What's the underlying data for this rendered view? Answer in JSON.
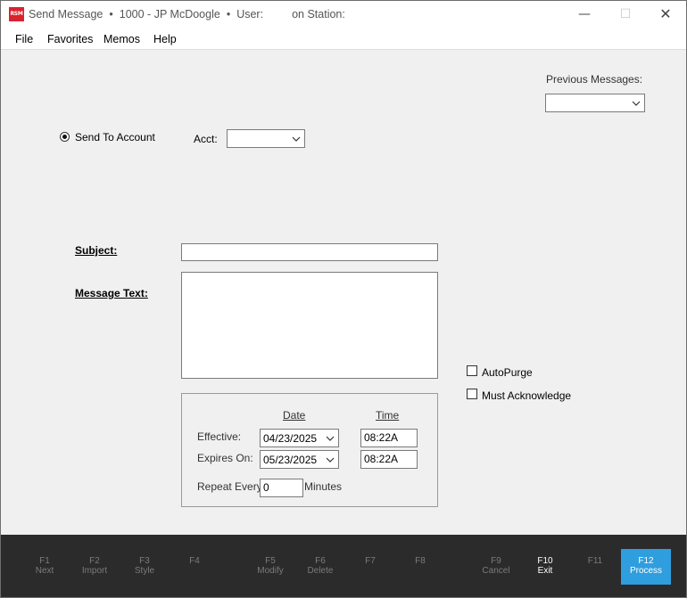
{
  "window": {
    "title": "Send Message",
    "account_info": "1000 - JP McDoogle",
    "user_label": "User:",
    "station_label": "on Station:",
    "logo_text": "RSM"
  },
  "menu": [
    "File",
    "Favorites",
    "Memos",
    "Help"
  ],
  "previous_messages": {
    "label": "Previous Messages:",
    "value": ""
  },
  "send_to_account": {
    "label": "Send To Account",
    "selected": true
  },
  "acct": {
    "label": "Acct:",
    "value": ""
  },
  "subject": {
    "label": "Subject:",
    "value": ""
  },
  "message_text": {
    "label": "Message Text:",
    "value": ""
  },
  "autopurge": {
    "label": "AutoPurge",
    "checked": false
  },
  "must_acknowledge": {
    "label": "Must Acknowledge",
    "checked": false
  },
  "schedule": {
    "date_header": "Date",
    "time_header": "Time",
    "effective_label": "Effective:",
    "effective_date": "04/23/2025",
    "effective_time": "08:22A",
    "expires_label": "Expires On:",
    "expires_date": "05/23/2025",
    "expires_time": "08:22A",
    "repeat_label": "Repeat Every",
    "repeat_value": "0",
    "minutes_label": "Minutes"
  },
  "fkeys": [
    {
      "key": "F1",
      "label": "Next"
    },
    {
      "key": "F2",
      "label": "Import"
    },
    {
      "key": "F3",
      "label": "Style"
    },
    {
      "key": "F4",
      "label": ""
    },
    {
      "key": "F5",
      "label": "Modify"
    },
    {
      "key": "F6",
      "label": "Delete"
    },
    {
      "key": "F7",
      "label": ""
    },
    {
      "key": "F8",
      "label": ""
    },
    {
      "key": "F9",
      "label": "Cancel"
    },
    {
      "key": "F10",
      "label": "Exit"
    },
    {
      "key": "F11",
      "label": ""
    },
    {
      "key": "F12",
      "label": "Process"
    }
  ],
  "colors": {
    "accent": "#2f9ede",
    "fkey_bar": "#2b2b2b",
    "logo": "#d9232e"
  }
}
